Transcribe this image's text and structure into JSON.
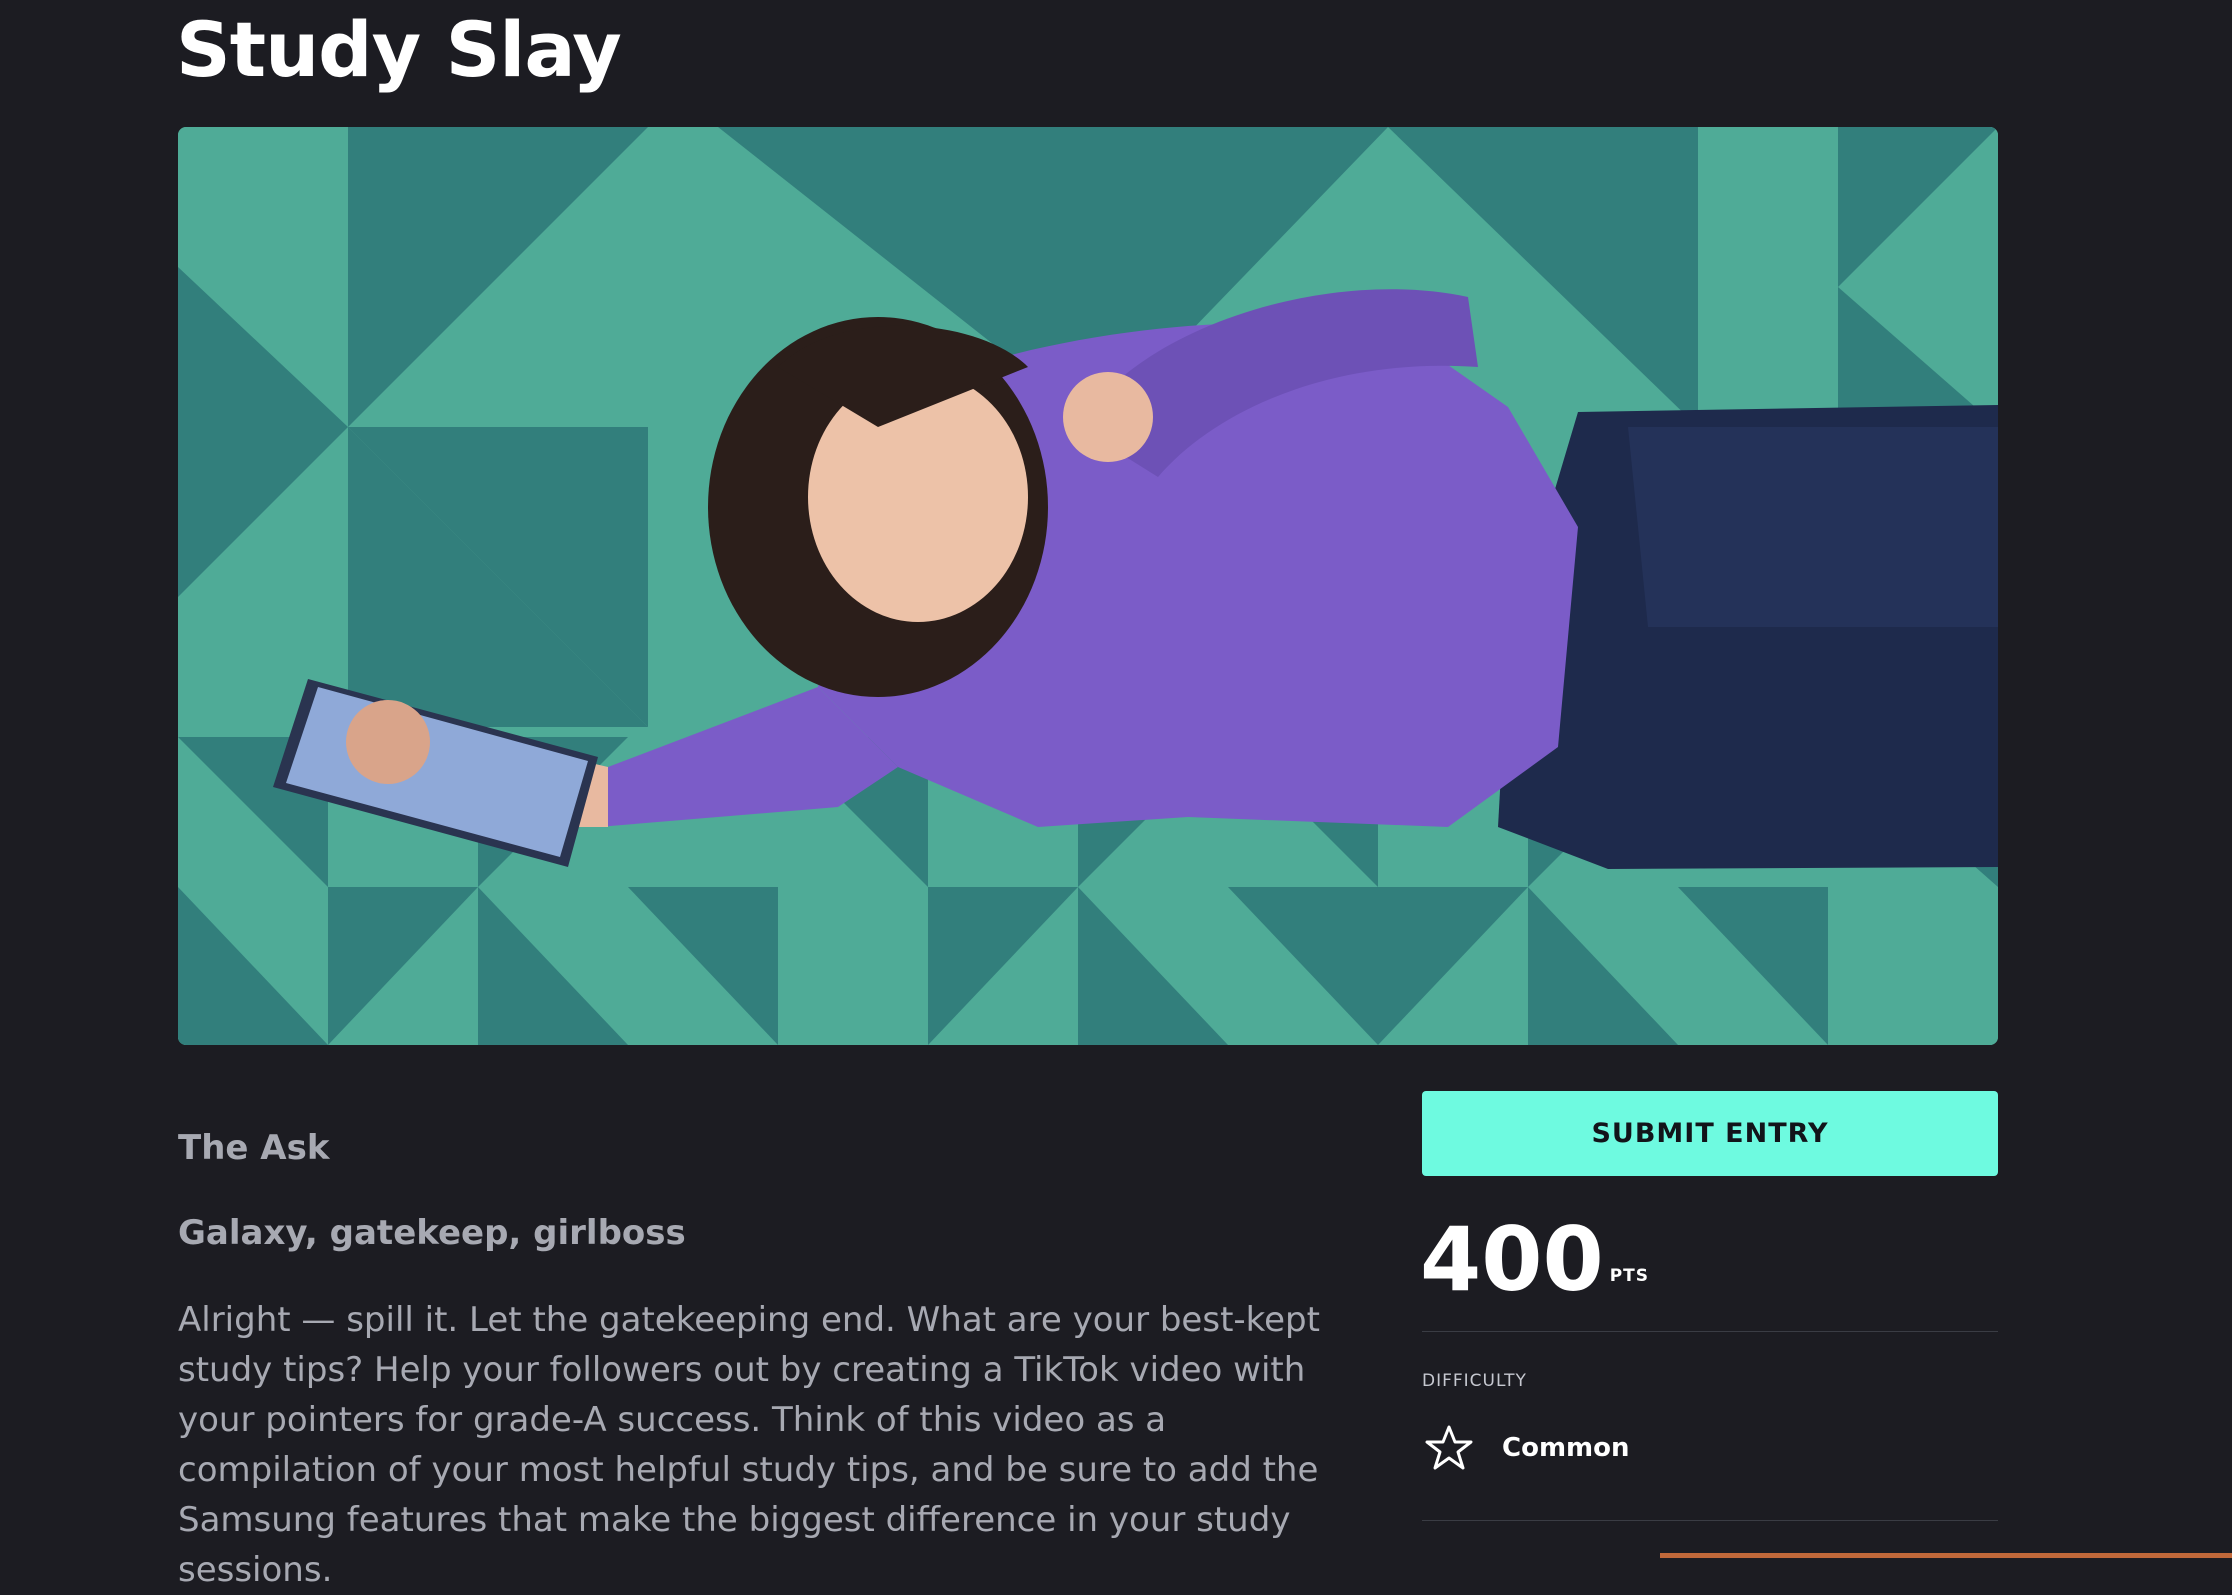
{
  "page": {
    "title": "Study Slay"
  },
  "hero": {
    "image": "challenge-hero-photo",
    "colors": {
      "light_teal": "#4fab97",
      "dark_teal": "#327f7c",
      "sweater": "#7b5cc8",
      "jeans": "#1e2a4c"
    }
  },
  "ask": {
    "heading": "The Ask",
    "subheading": "Galaxy, gatekeep, girlboss",
    "body": "Alright — spill it. Let the gatekeeping end. What are your best-kept study tips? Help your followers out by creating a TikTok video with your pointers for grade-A success. Think of this video as a compilation of your most helpful study tips, and be sure to add the Samsung features that make the biggest difference in your study sessions."
  },
  "sidebar": {
    "submit_label": "SUBMIT ENTRY",
    "points_value": "400",
    "points_unit": "PTS",
    "difficulty_label": "DIFFICULTY",
    "difficulty_value": "Common",
    "difficulty_icon": "star-icon"
  },
  "colors": {
    "background": "#1c1c22",
    "accent": "#6efae0",
    "muted_text": "#a7a9b2"
  }
}
